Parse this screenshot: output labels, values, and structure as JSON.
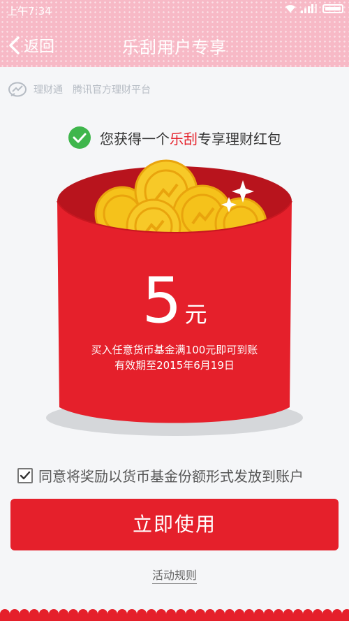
{
  "status_bar": {
    "time": "上午7:34"
  },
  "header": {
    "back_label": "返回",
    "title": "乐刮用户专享"
  },
  "brand": {
    "name": "理财通",
    "tagline": "腾讯官方理财平台"
  },
  "headline": {
    "prefix": "您获得一个",
    "highlight": "乐刮",
    "suffix": "专享理财红包"
  },
  "red_packet": {
    "amount": "5",
    "unit": "元",
    "condition": "买入任意货币基金满100元即可到账",
    "validity": "有效期至2015年6月19日"
  },
  "agreement": {
    "checked": true,
    "text": "同意将奖励以货币基金份额形式发放到账户"
  },
  "actions": {
    "use_now": "立即使用",
    "rules": "活动规则"
  },
  "colors": {
    "accent_red": "#e5202b",
    "header_pink": "#f7b9c6",
    "coin_gold": "#f5c21b",
    "check_green": "#3fb64c"
  }
}
